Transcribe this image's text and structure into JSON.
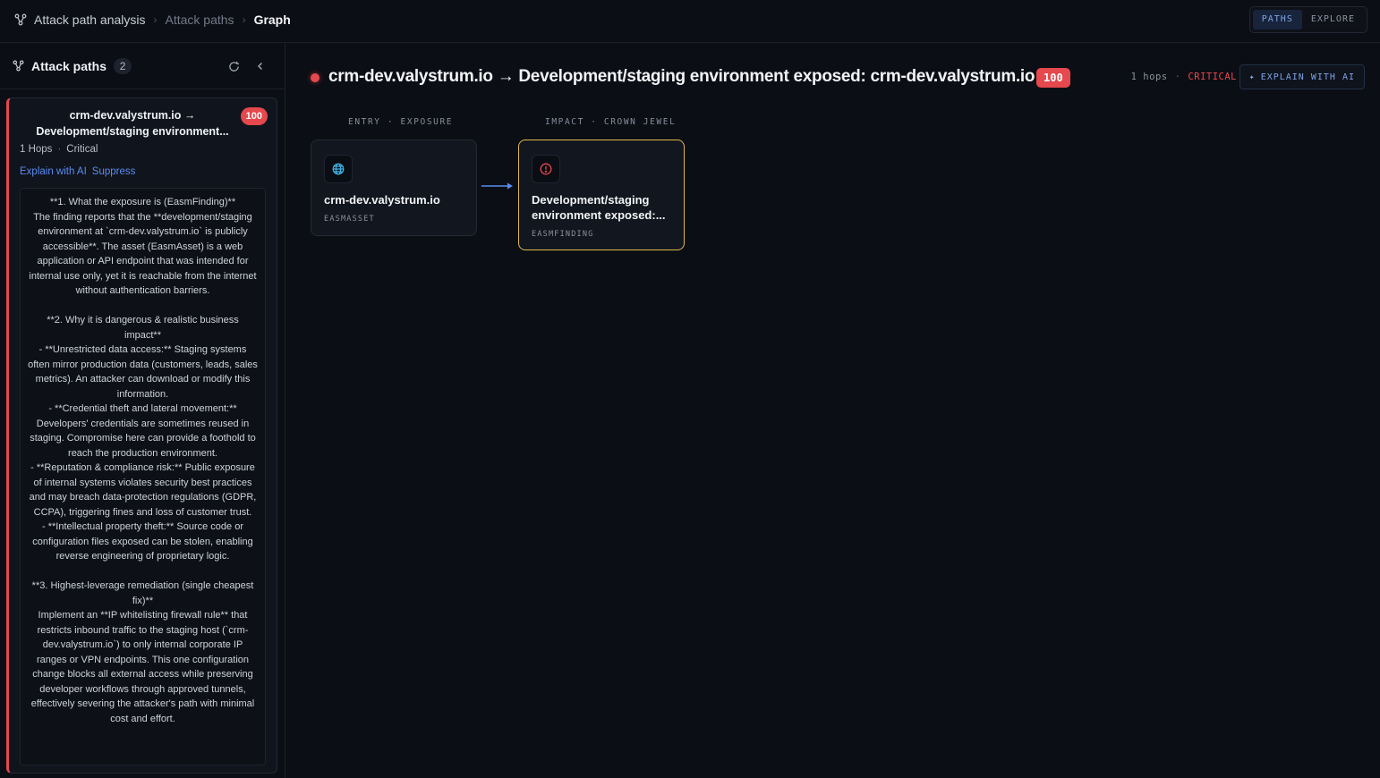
{
  "breadcrumb": {
    "root": "Attack path analysis",
    "middle": "Attack paths",
    "current": "Graph"
  },
  "view_toggle": {
    "paths": "PATHS",
    "explore": "EXPLORE",
    "active": "PATHS"
  },
  "sidebar": {
    "title": "Attack paths",
    "count": "2",
    "cards": [
      {
        "title": "crm-dev.valystrum.io → Development/staging environment...",
        "score": "100",
        "hops": "1 Hops",
        "severity": "Critical",
        "explain_link": "Explain with AI",
        "suppress_link": "Suppress",
        "explanation": "**1. What the exposure is (EasmFinding)**\nThe finding reports that the **development/staging environment at `crm-dev.valystrum.io` is publicly accessible**. The asset (EasmAsset) is a web application or API endpoint that was intended for internal use only, yet it is reachable from the internet without authentication barriers.\n\n**2. Why it is dangerous & realistic business impact**\n- **Unrestricted data access:** Staging systems often mirror production data (customers, leads, sales metrics). An attacker can download or modify this information.\n- **Credential theft and lateral movement:** Developers' credentials are sometimes reused in staging. Compromise here can provide a foothold to reach the production environment.\n- **Reputation & compliance risk:** Public exposure of internal systems violates security best practices and may breach data-protection regulations (GDPR, CCPA), triggering fines and loss of customer trust.\n- **Intellectual property theft:** Source code or configuration files exposed can be stolen, enabling reverse engineering of proprietary logic.\n\n**3. Highest-leverage remediation (single cheapest fix)**\nImplement an **IP whitelisting firewall rule** that restricts inbound traffic to the staging host (`crm-dev.valystrum.io`) to only internal corporate IP ranges or VPN endpoints. This one configuration change blocks all external access while preserving developer workflows through approved tunnels, effectively severing the attacker's path with minimal cost and effort."
      }
    ]
  },
  "path": {
    "title": "crm-dev.valystrum.io → Development/staging environment exposed: crm-dev.valystrum.io",
    "score": "100",
    "hops": "1 hops",
    "severity": "CRITICAL",
    "explain_button": "EXPLAIN WITH AI"
  },
  "graph": {
    "entry_label": "ENTRY · EXPOSURE",
    "impact_label": "IMPACT · CROWN JEWEL",
    "nodes": [
      {
        "name": "crm-dev.valystrum.io",
        "kind": "EASMASSET",
        "icon": "globe-icon",
        "icon_color": "#3fb4e6"
      },
      {
        "name": "Development/staging environment exposed:...",
        "kind": "EASMFINDING",
        "icon": "alert-circle-icon",
        "icon_color": "#e5484d"
      }
    ],
    "edge_color": "#5b8cf0",
    "crown_border": "#e0b84a"
  }
}
